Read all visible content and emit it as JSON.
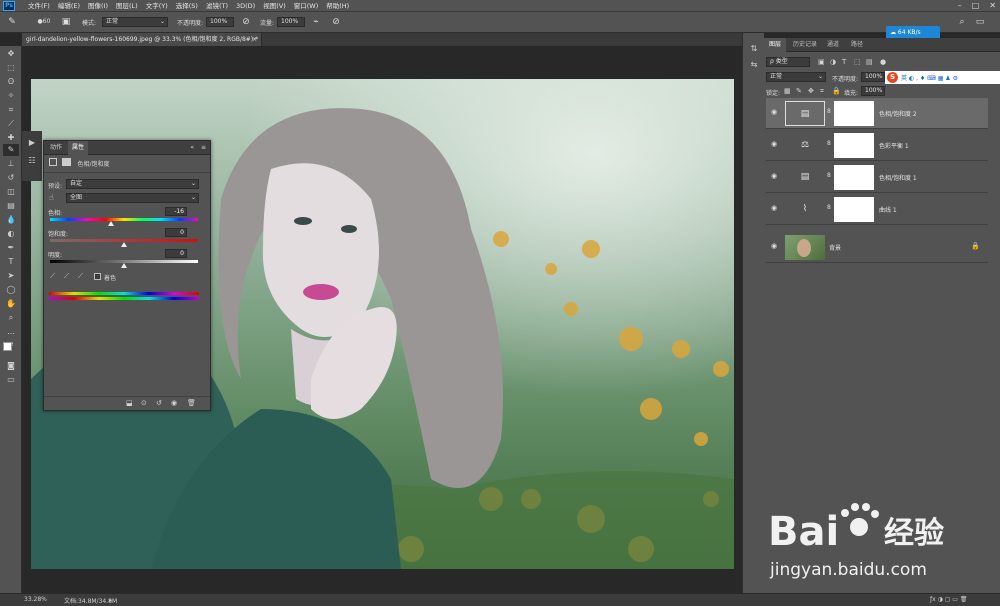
{
  "app": {
    "logo": "Ps"
  },
  "menubar": {
    "items": [
      "文件(F)",
      "编辑(E)",
      "图像(I)",
      "图层(L)",
      "文字(Y)",
      "选择(S)",
      "滤镜(T)",
      "3D(D)",
      "视图(V)",
      "窗口(W)",
      "帮助(H)"
    ]
  },
  "optionsbar": {
    "brush_size": "60",
    "mode_label": "模式:",
    "mode_value": "正常",
    "opacity_label": "不透明度:",
    "opacity_value": "100%",
    "flow_label": "流量:",
    "flow_value": "100%",
    "net_speed": "64 KB/s"
  },
  "document": {
    "tab_title": "girl-dandelion-yellow-flowers-160699.jpeg @ 33.3% (色相/饱和度 2, RGB/8#) *"
  },
  "properties": {
    "tab_actions": "动作",
    "tab_properties": "属性",
    "panel_type": "色相/饱和度",
    "preset_label": "预设:",
    "preset_value": "自定",
    "channel_value": "全图",
    "hue_label": "色相:",
    "hue_value": "-16",
    "hue_position": 0.41,
    "saturation_label": "饱和度:",
    "saturation_value": "0",
    "saturation_position": 0.5,
    "lightness_label": "明度:",
    "lightness_value": "0",
    "lightness_position": 0.5,
    "colorize_label": "着色"
  },
  "layers_panel": {
    "tabs": [
      "图层",
      "历史记录",
      "通道",
      "路径"
    ],
    "kind_label": "ρ 类型",
    "blend_mode": "正常",
    "opacity_label": "不透明度:",
    "opacity_value": "100%",
    "lock_label": "锁定:",
    "fill_label": "填充:",
    "fill_value": "100%",
    "layers": [
      {
        "name": "色相/饱和度 2",
        "icon": "hue-saturation-icon",
        "selected": true
      },
      {
        "name": "色彩平衡 1",
        "icon": "color-balance-icon",
        "selected": false
      },
      {
        "name": "色相/饱和度 1",
        "icon": "hue-saturation-icon",
        "selected": false
      },
      {
        "name": "曲线 1",
        "icon": "curves-icon",
        "selected": false
      },
      {
        "name": "背景",
        "icon": "image-thumbnail",
        "selected": false
      }
    ]
  },
  "statusbar": {
    "zoom": "33.28%",
    "doc_size": "文档:34.8M/34.8M"
  },
  "watermark": {
    "logo_text": "Bai",
    "logo_text2": "经验",
    "url": "jingyan.baidu.com"
  },
  "colors": {
    "panel_bg": "#535353",
    "dark_bg": "#282828",
    "accent": "#1e88d6",
    "red": "#cc1f1f"
  }
}
